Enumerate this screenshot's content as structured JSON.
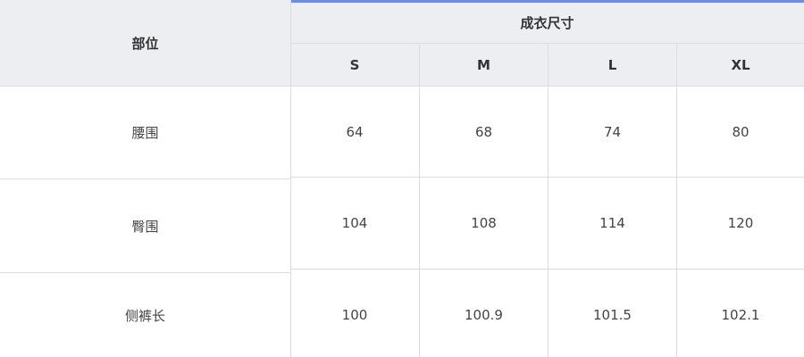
{
  "colors": {
    "header_bg": "#eceef2",
    "grid": "#dcdde1",
    "accent": "#6f8de0",
    "text": "#333333"
  },
  "table": {
    "part_header": "部位",
    "size_group_header": "成衣尺寸",
    "sizes": [
      "S",
      "M",
      "L",
      "XL"
    ],
    "rows": [
      {
        "part": "腰围",
        "values": [
          "64",
          "68",
          "74",
          "80"
        ]
      },
      {
        "part": "臀围",
        "values": [
          "104",
          "108",
          "114",
          "120"
        ]
      },
      {
        "part": "侧裤长",
        "values": [
          "100",
          "100.9",
          "101.5",
          "102.1"
        ]
      }
    ]
  }
}
